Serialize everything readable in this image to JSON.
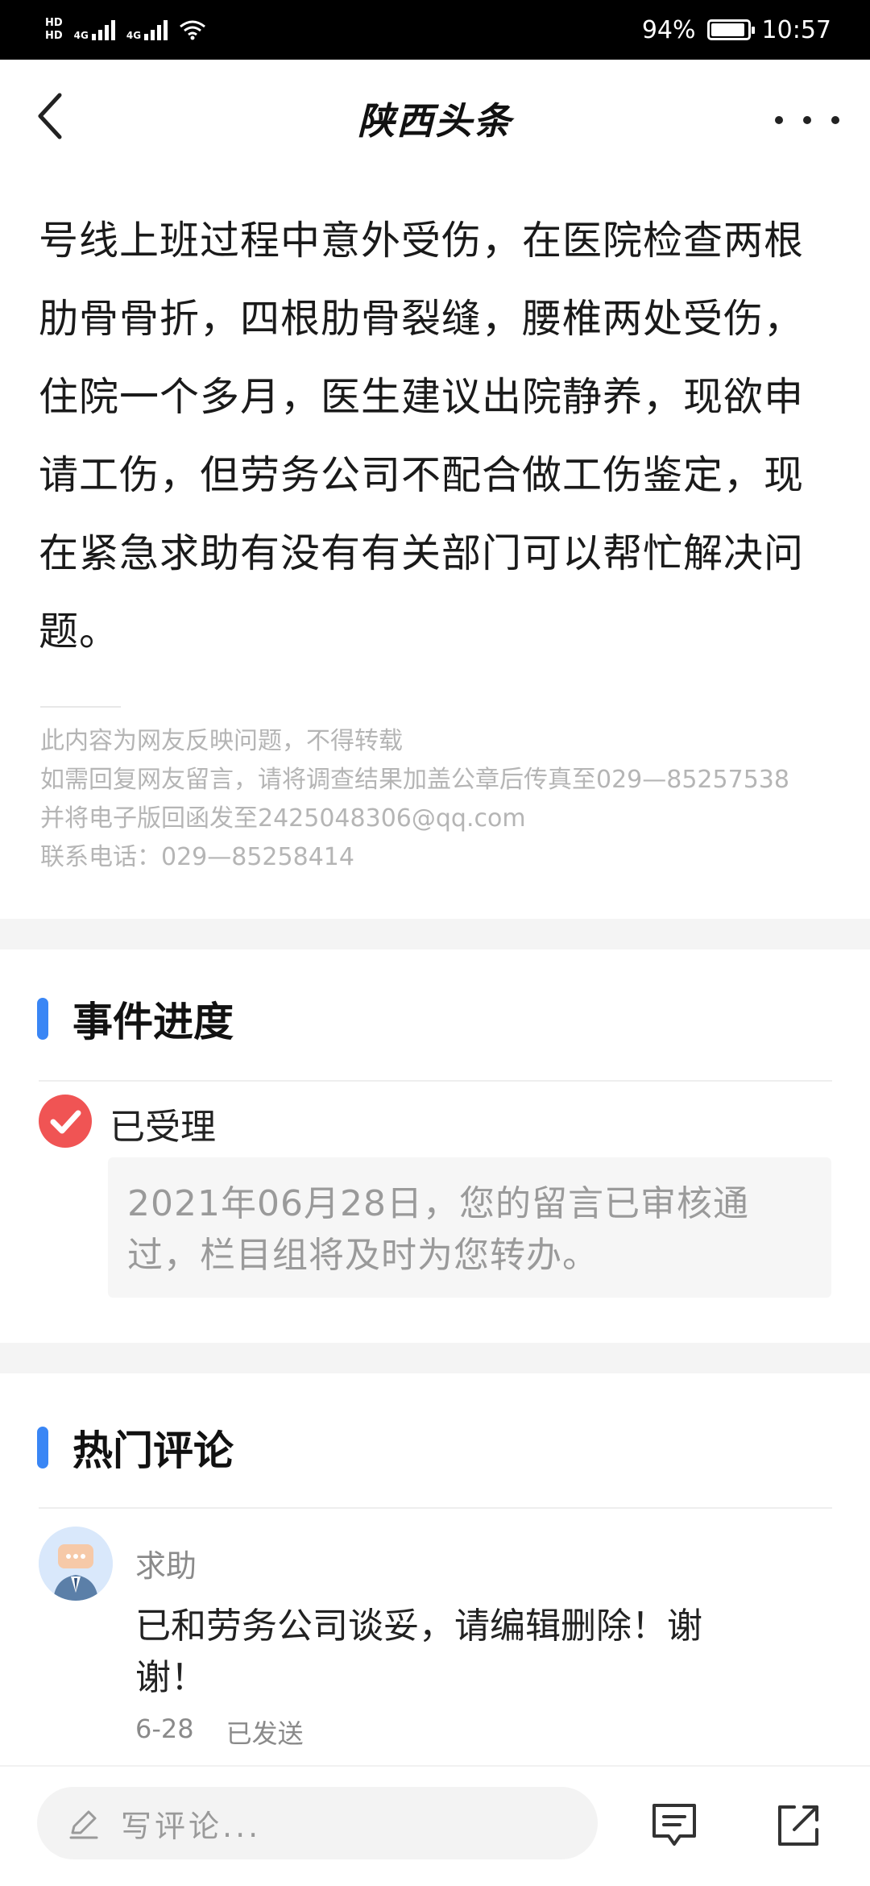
{
  "status_bar": {
    "hd1": "HD",
    "hd2": "HD",
    "net1": "4G",
    "net2": "4G",
    "battery_percent": "94%",
    "battery_level": 0.94,
    "time": "10:57",
    "icons": [
      "signal-icon",
      "wifi-icon",
      "battery-icon"
    ]
  },
  "header": {
    "title": "陕西头条",
    "back_icon": "chevron-left-icon",
    "more_icon": "more-dots-icon"
  },
  "article": {
    "text": "号线上班过程中意外受伤，在医院检查两根肋骨骨折，四根肋骨裂缝，腰椎两处受伤，住院一个多月，医生建议出院静养，现欲申请工伤，但劳务公司不配合做工伤鉴定，现在紧急求助有没有有关部门可以帮忙解决问题。"
  },
  "notice": {
    "line1": "此内容为网友反映问题，不得转载",
    "line2": "如需回复网友留言，请将调查结果加盖公章后传真至029—85257538",
    "line3": "并将电子版回函发至2425048306@qq.com",
    "line4": "联系电话：029—85258414"
  },
  "progress": {
    "title": "事件进度",
    "status": "已受理",
    "detail": "2021年06月28日，您的留言已审核通过，栏目组将及时为您转办。"
  },
  "comments": {
    "title": "热门评论",
    "items": [
      {
        "user": "求助",
        "text": "已和劳务公司谈妥，请编辑删除！谢谢！",
        "date": "6-28",
        "status": "已发送"
      }
    ]
  },
  "bottom_bar": {
    "input_placeholder": "写评论...",
    "comment_icon": "comment-icon",
    "share_icon": "share-icon"
  },
  "colors": {
    "accent_blue": "#3a86f5",
    "check_red": "#f05454"
  }
}
